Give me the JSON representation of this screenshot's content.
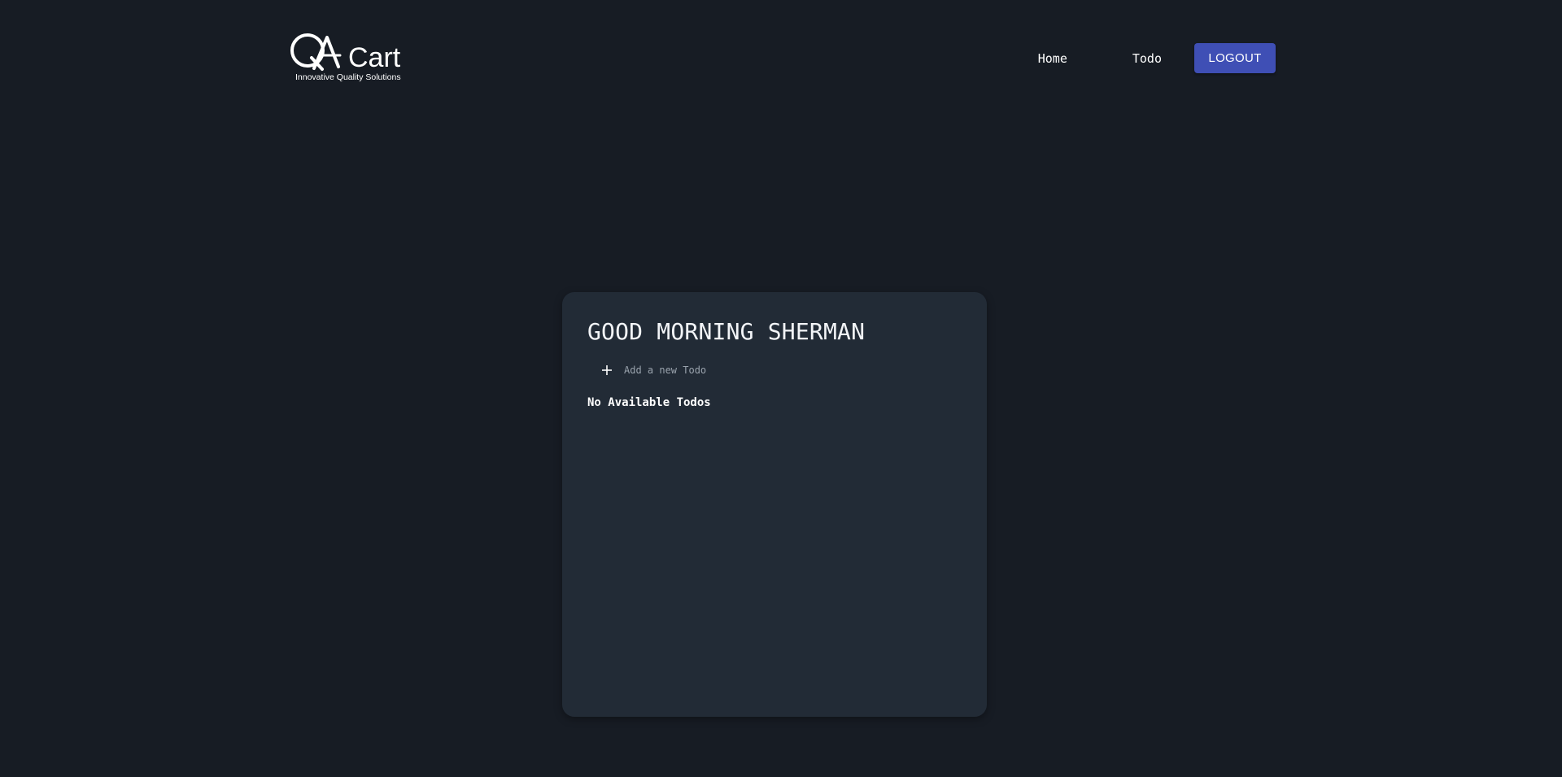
{
  "header": {
    "logo": {
      "brand": "QACart",
      "tagline": "Innovative Quality Solutions"
    },
    "nav": {
      "home_label": "Home",
      "todo_label": "Todo",
      "logout_label": "LOGOUT"
    }
  },
  "main": {
    "greeting": "GOOD MORNING SHERMAN",
    "add_todo": {
      "placeholder": "Add a new Todo",
      "value": "",
      "icon": "plus-icon"
    },
    "empty_message": "No Available Todos"
  },
  "colors": {
    "background": "#171c24",
    "card": "#222b36",
    "accent": "#3f4fb5",
    "text": "#ffffff",
    "placeholder": "#9aa3ad"
  }
}
